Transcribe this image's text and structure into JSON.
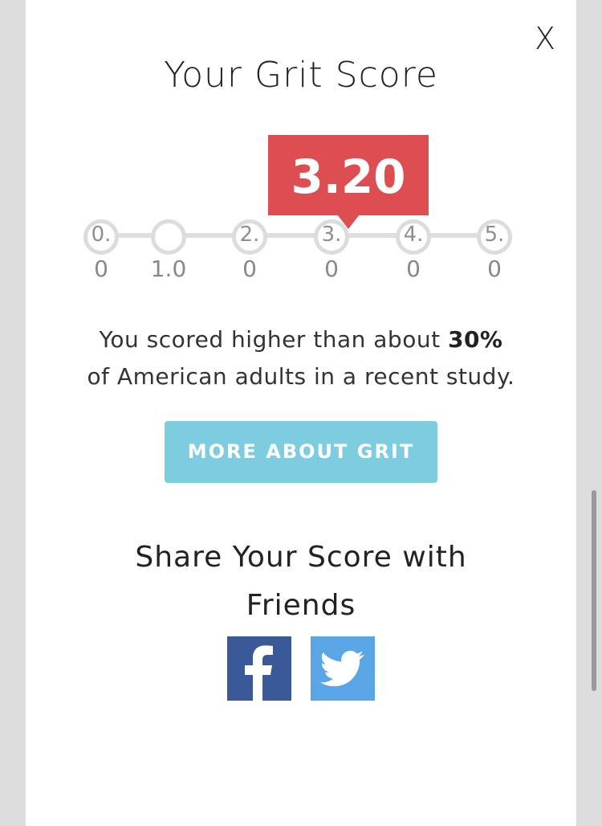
{
  "modal": {
    "close_label": "X",
    "title": "Your Grit Score"
  },
  "score": {
    "value": "3.20",
    "flag_color": "#dc4e51"
  },
  "scale": {
    "ticks": [
      {
        "top": "0.",
        "bottom": "0"
      },
      {
        "top": "",
        "bottom": "1.0"
      },
      {
        "top": "2.",
        "bottom": "0"
      },
      {
        "top": "3.",
        "bottom": "0"
      },
      {
        "top": "4.",
        "bottom": "0"
      },
      {
        "top": "5.",
        "bottom": "0"
      }
    ]
  },
  "result": {
    "prefix": "You scored higher than about ",
    "percent": "30%",
    "suffix": "of American adults in a recent study."
  },
  "more_button": {
    "label": "MORE ABOUT GRIT",
    "color": "#7dcce0"
  },
  "share": {
    "line1": "Share Your Score with",
    "line2": "Friends",
    "facebook_icon": "facebook-icon",
    "twitter_icon": "twitter-icon",
    "facebook_color": "#3b5998",
    "twitter_color": "#5aa5e6"
  }
}
